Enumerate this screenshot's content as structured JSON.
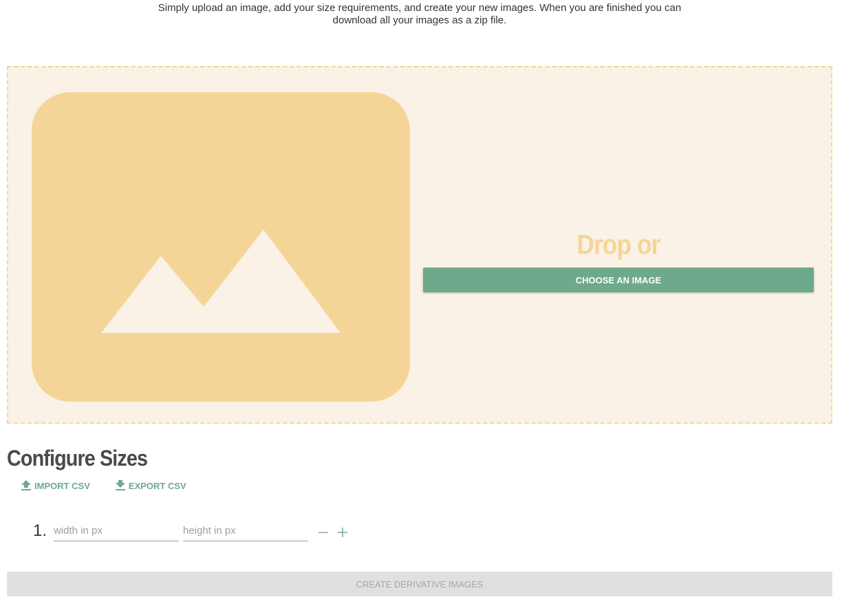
{
  "intro": {
    "line1": "Simply upload an image, add your size requirements, and create your new images. When you are finished you can",
    "line2": "download all your images as a zip file."
  },
  "dropzone": {
    "drop_text": "Drop or",
    "choose_label": "CHOOSE AN IMAGE",
    "placeholder_icon": "image-placeholder-icon"
  },
  "configure": {
    "title": "Configure Sizes",
    "import_label": "IMPORT CSV",
    "export_label": "EXPORT CSV",
    "rows": [
      {
        "index": "1.",
        "width_placeholder": "width in px",
        "height_placeholder": "height in px",
        "width_value": "",
        "height_value": ""
      }
    ]
  },
  "create_label": "CREATE DERIVATIVE IMAGES",
  "colors": {
    "accent": "#6daa8b",
    "dropzone_bg": "#faf2e6",
    "dropzone_border": "#f5d597",
    "disabled_bg": "#e0e0e0",
    "disabled_text": "#a6a6a6"
  }
}
